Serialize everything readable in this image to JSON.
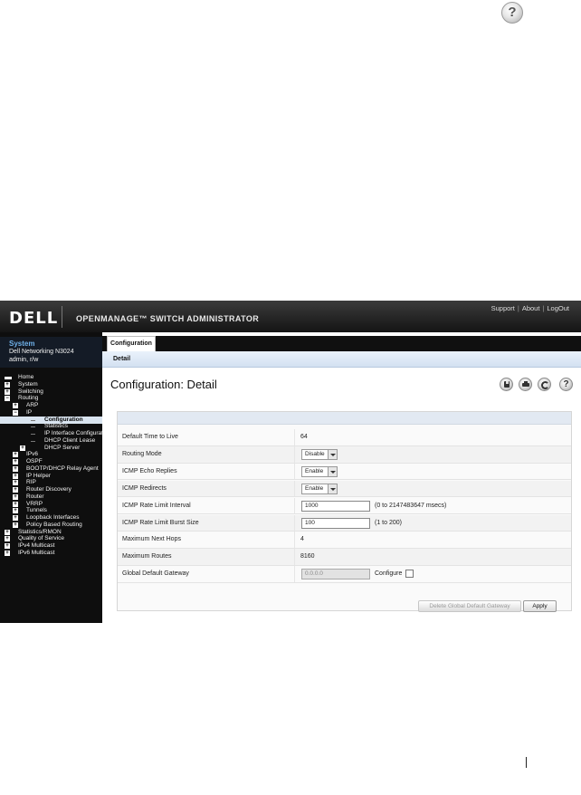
{
  "doc_help_glyph": "?",
  "header": {
    "logo": "DELL",
    "product": "OPENMANAGE™ SWITCH ADMINISTRATOR",
    "links": [
      "Support",
      "About",
      "LogOut"
    ],
    "link_separator": "|"
  },
  "system": {
    "title": "System",
    "model": "Dell Networking N3024",
    "user": "admin, r/w"
  },
  "nav": [
    {
      "label": "Home",
      "level": 0,
      "icon": "home-icon"
    },
    {
      "label": "System",
      "level": 0,
      "expander": "+"
    },
    {
      "label": "Switching",
      "level": 0,
      "expander": "+"
    },
    {
      "label": "Routing",
      "level": 0,
      "expander": "−"
    },
    {
      "label": "ARP",
      "level": 1,
      "expander": "+"
    },
    {
      "label": "IP",
      "level": 1,
      "expander": "−"
    },
    {
      "label": "Configuration",
      "level": 2,
      "selected": true
    },
    {
      "label": "Statistics",
      "level": 2
    },
    {
      "label": "IP Interface Configuration",
      "level": 2
    },
    {
      "label": "DHCP Client Lease",
      "level": 2
    },
    {
      "label": "DHCP Server",
      "level": 2,
      "expander": "+"
    },
    {
      "label": "IPv6",
      "level": 1,
      "expander": "+"
    },
    {
      "label": "OSPF",
      "level": 1,
      "expander": "+"
    },
    {
      "label": "BOOTP/DHCP Relay Agent",
      "level": 1,
      "expander": "+"
    },
    {
      "label": "IP Helper",
      "level": 1,
      "expander": "+"
    },
    {
      "label": "RIP",
      "level": 1,
      "expander": "+"
    },
    {
      "label": "Router Discovery",
      "level": 1,
      "expander": "+"
    },
    {
      "label": "Router",
      "level": 1,
      "expander": "+"
    },
    {
      "label": "VRRP",
      "level": 1,
      "expander": "+"
    },
    {
      "label": "Tunnels",
      "level": 1,
      "expander": "+"
    },
    {
      "label": "Loopback Interfaces",
      "level": 1,
      "expander": "+"
    },
    {
      "label": "Policy Based Routing",
      "level": 1,
      "expander": "+"
    },
    {
      "label": "Statistics/RMON",
      "level": 0,
      "expander": "+"
    },
    {
      "label": "Quality of Service",
      "level": 0,
      "expander": "+"
    },
    {
      "label": "IPv4 Multicast",
      "level": 0,
      "expander": "+"
    },
    {
      "label": "IPv6 Multicast",
      "level": 0,
      "expander": "+"
    }
  ],
  "tabs": {
    "main": "Configuration",
    "sub": "Detail"
  },
  "page_title": "Configuration: Detail",
  "toolbar": {
    "help_glyph": "?"
  },
  "form": {
    "rows": [
      {
        "label": "Default Time to Live",
        "type": "text",
        "value": "64"
      },
      {
        "label": "Routing Mode",
        "type": "select",
        "value": "Disable"
      },
      {
        "label": "ICMP Echo Replies",
        "type": "select",
        "value": "Enable"
      },
      {
        "label": "ICMP Redirects",
        "type": "select",
        "value": "Enable"
      },
      {
        "label": "ICMP Rate Limit Interval",
        "type": "input",
        "value": "1000",
        "range": "(0 to 2147483647 msecs)"
      },
      {
        "label": "ICMP Rate Limit Burst Size",
        "type": "input",
        "value": "100",
        "range": "(1 to 200)"
      },
      {
        "label": "Maximum Next Hops",
        "type": "text",
        "value": "4"
      },
      {
        "label": "Maximum Routes",
        "type": "text",
        "value": "8160"
      },
      {
        "label": "Global Default Gateway",
        "type": "input-disabled",
        "value": "0.0.0.0",
        "configure_label": "Configure"
      }
    ]
  },
  "buttons": {
    "delete_gateway": "Delete Global Default Gateway",
    "apply": "Apply"
  },
  "colors": {
    "header_dark": "#141414",
    "sidebar_bg": "#0e0e0e",
    "system_title": "#6fb0e8",
    "subtab_bg": "#d3e1f1"
  }
}
